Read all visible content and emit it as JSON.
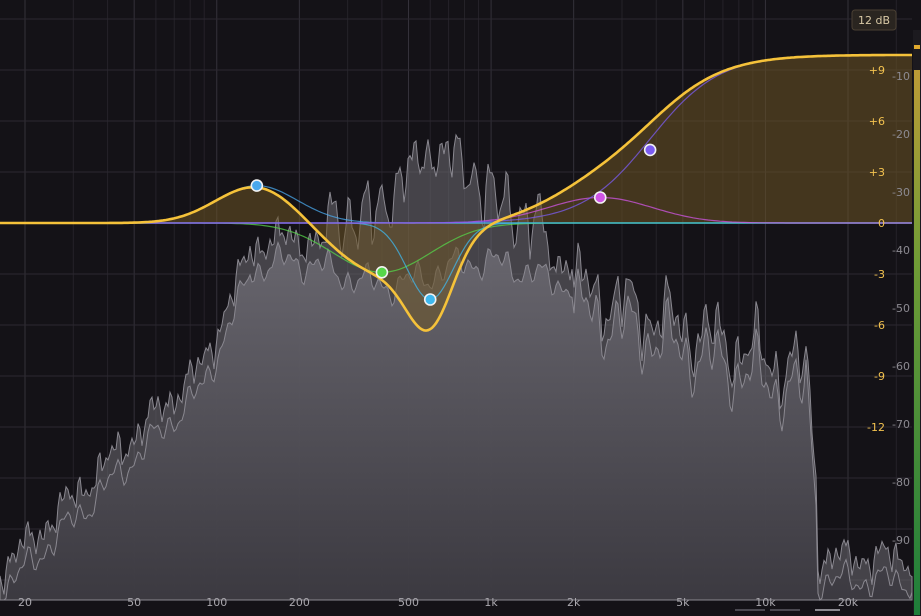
{
  "range_button": {
    "label": "12 dB"
  },
  "corner_label": "0",
  "freq_axis": {
    "labels": [
      {
        "text": "20",
        "hz": 20
      },
      {
        "text": "50",
        "hz": 50
      },
      {
        "text": "100",
        "hz": 100
      },
      {
        "text": "200",
        "hz": 200
      },
      {
        "text": "500",
        "hz": 500
      },
      {
        "text": "1k",
        "hz": 1000
      },
      {
        "text": "2k",
        "hz": 2000
      },
      {
        "text": "5k",
        "hz": 5000
      },
      {
        "text": "10k",
        "hz": 10000
      },
      {
        "text": "20k",
        "hz": 20000
      }
    ],
    "min_hz": 20,
    "max_hz": 30000
  },
  "gain_axis": {
    "labels": [
      {
        "text": "+9",
        "db": 9
      },
      {
        "text": "+6",
        "db": 6
      },
      {
        "text": "+3",
        "db": 3
      },
      {
        "text": "0",
        "db": 0
      },
      {
        "text": "-3",
        "db": -3
      },
      {
        "text": "-6",
        "db": -6
      },
      {
        "text": "-9",
        "db": -9
      },
      {
        "text": "-12",
        "db": -12
      }
    ],
    "range_db": 13
  },
  "spectrum_axis": {
    "labels": [
      {
        "text": "-10",
        "db": -10
      },
      {
        "text": "-20",
        "db": -20
      },
      {
        "text": "-30",
        "db": -30
      },
      {
        "text": "-40",
        "db": -40
      },
      {
        "text": "-50",
        "db": -50
      },
      {
        "text": "-60",
        "db": -60
      },
      {
        "text": "-70",
        "db": -70
      },
      {
        "text": "-80",
        "db": -80
      },
      {
        "text": "-90",
        "db": -90
      }
    ]
  },
  "bands": [
    {
      "name": "band-1",
      "type": "bell",
      "freq": 140,
      "gain": 2.2,
      "color": "#4aa8ec"
    },
    {
      "name": "band-2",
      "type": "bell",
      "freq": 400,
      "gain": -2.9,
      "color": "#56d64a"
    },
    {
      "name": "band-3",
      "type": "bell",
      "freq": 600,
      "gain": -4.5,
      "color": "#3fb8ee"
    },
    {
      "name": "band-4",
      "type": "bell",
      "freq": 2500,
      "gain": 1.5,
      "color": "#d055e6"
    },
    {
      "name": "band-5",
      "type": "high-shelf",
      "freq": 3800,
      "gain": 4.3,
      "color": "#7b5cf0"
    }
  ],
  "colors": {
    "background": "#141217",
    "eq_curve": "#f5c23a",
    "eq_fill": "#5a4724",
    "spectrum": "#5b5960",
    "zero_line": "#49b8ae"
  }
}
